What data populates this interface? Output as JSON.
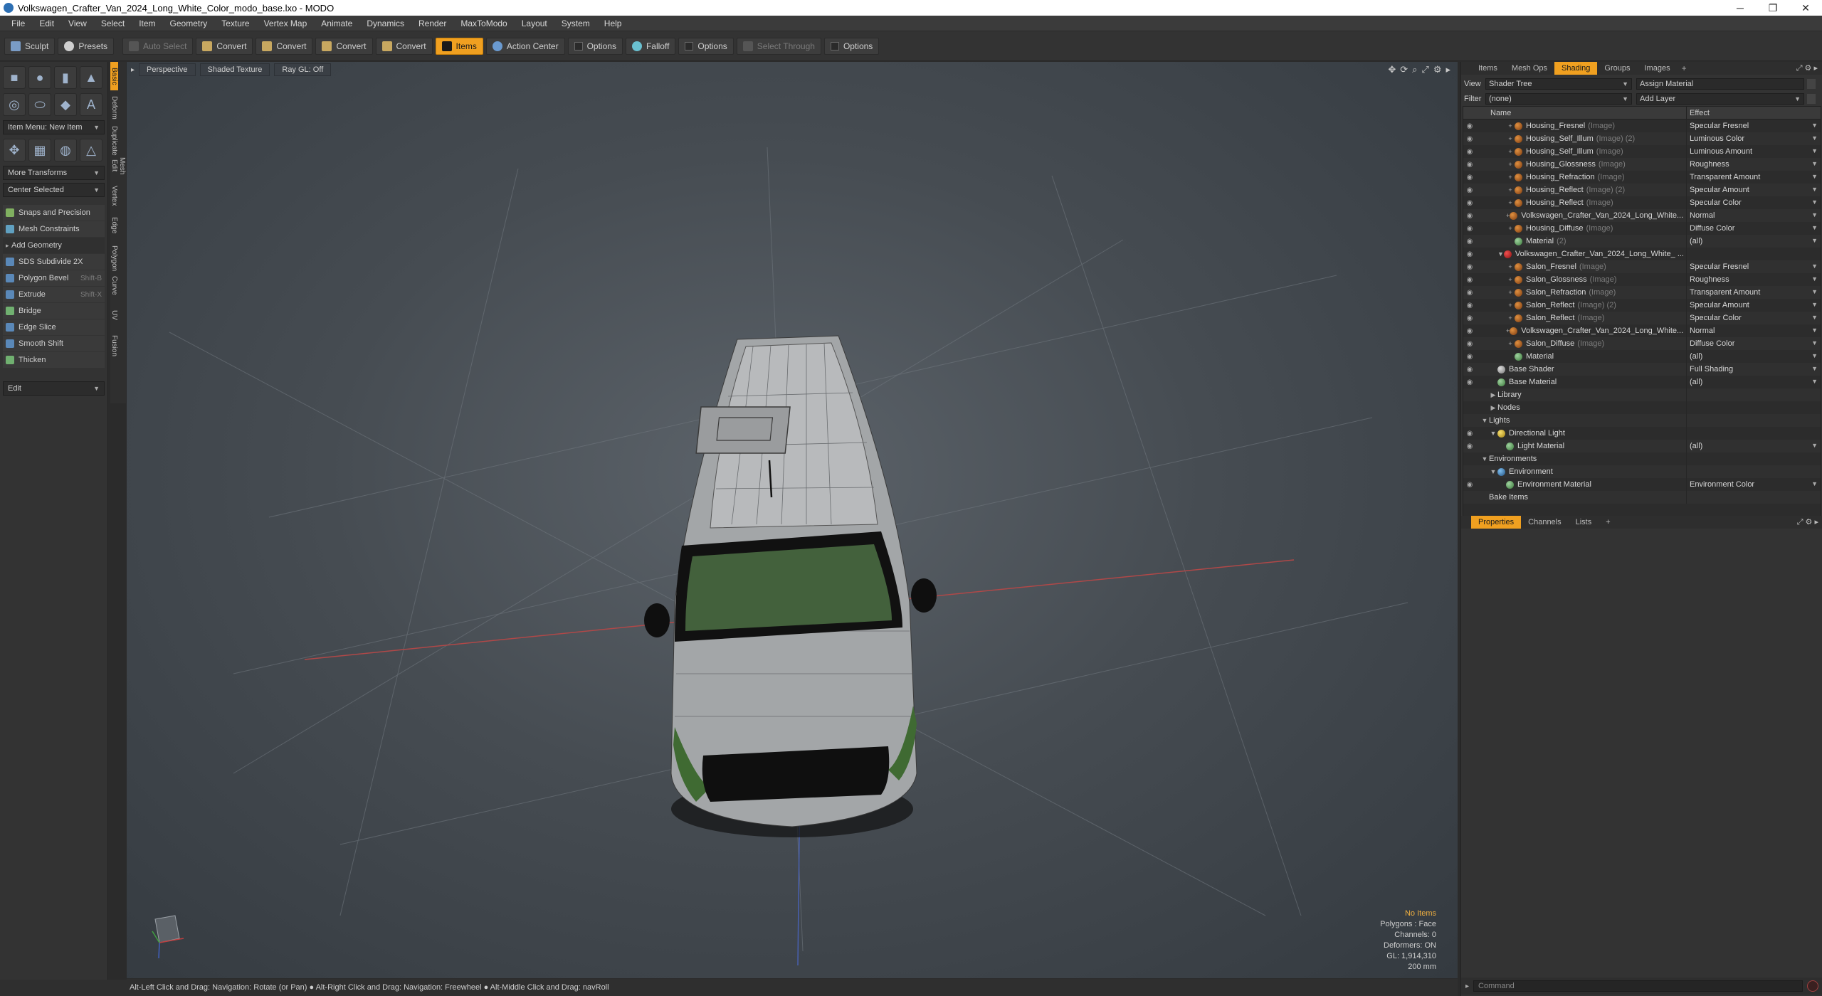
{
  "window": {
    "title": "Volkswagen_Crafter_Van_2024_Long_White_Color_modo_base.lxo - MODO",
    "minimize": "─",
    "maximize": "❐",
    "close": "✕"
  },
  "menu": [
    "File",
    "Edit",
    "View",
    "Select",
    "Item",
    "Geometry",
    "Texture",
    "Vertex Map",
    "Animate",
    "Dynamics",
    "Render",
    "MaxToModo",
    "Layout",
    "System",
    "Help"
  ],
  "toolbar": {
    "sculpt": "Sculpt",
    "presets": "Presets",
    "auto_select": "Auto Select",
    "convert1": "Convert",
    "convert2": "Convert",
    "convert3": "Convert",
    "convert4": "Convert",
    "items": "Items",
    "action_center": "Action Center",
    "options1": "Options",
    "falloff": "Falloff",
    "options2": "Options",
    "select_through": "Select Through",
    "options3": "Options"
  },
  "left": {
    "item_menu": "Item Menu: New Item",
    "more_transforms": "More Transforms",
    "center_selected": "Center Selected",
    "snaps": "Snaps and Precision",
    "constraints": "Mesh Constraints",
    "add_geometry": "Add Geometry",
    "tools": [
      {
        "label": "SDS Subdivide 2X",
        "shortcut": ""
      },
      {
        "label": "Polygon Bevel",
        "shortcut": "Shift-B"
      },
      {
        "label": "Extrude",
        "shortcut": "Shift-X"
      },
      {
        "label": "Bridge",
        "shortcut": ""
      },
      {
        "label": "Edge Slice",
        "shortcut": ""
      },
      {
        "label": "Smooth Shift",
        "shortcut": ""
      },
      {
        "label": "Thicken",
        "shortcut": ""
      }
    ],
    "edit": "Edit",
    "vtabs": [
      "Basic",
      "Deform",
      "Duplicate",
      "Mesh Edit",
      "Vertex",
      "Edge",
      "Polygon",
      "Curve",
      "UV",
      "Fusion"
    ]
  },
  "viewport": {
    "perspective": "Perspective",
    "shaded": "Shaded Texture",
    "raygl": "Ray GL: Off",
    "info": {
      "items": "No Items",
      "polygons": "Polygons : Face",
      "channels": "Channels: 0",
      "deformers": "Deformers: ON",
      "gl": "GL: 1,914,310",
      "scale": "200 mm"
    }
  },
  "status": "Alt-Left Click and Drag: Navigation: Rotate (or Pan) ● Alt-Right Click and Drag: Navigation: Freewheel ● Alt-Middle Click and Drag: navRoll",
  "right": {
    "tabs": [
      "Items",
      "Mesh Ops",
      "Shading",
      "Groups",
      "Images"
    ],
    "view_label": "View",
    "view_value": "Shader Tree",
    "assign_material": "Assign Material",
    "filter_label": "Filter",
    "filter_value": "(none)",
    "add_layer": "Add Layer",
    "col_name": "Name",
    "col_effect": "Effect",
    "rows": [
      {
        "indent": 3,
        "icon": "dot",
        "name": "Housing_Fresnel",
        "tag": "(Image)",
        "effect": "Specular Fresnel",
        "eye": true
      },
      {
        "indent": 3,
        "icon": "dot",
        "name": "Housing_Self_Illum",
        "tag": "(Image) (2)",
        "effect": "Luminous Color",
        "eye": true
      },
      {
        "indent": 3,
        "icon": "dot",
        "name": "Housing_Self_Illum",
        "tag": "(Image)",
        "effect": "Luminous Amount",
        "eye": true
      },
      {
        "indent": 3,
        "icon": "dot",
        "name": "Housing_Glossness",
        "tag": "(Image)",
        "effect": "Roughness",
        "eye": true
      },
      {
        "indent": 3,
        "icon": "dot",
        "name": "Housing_Refraction",
        "tag": "(Image)",
        "effect": "Transparent Amount",
        "eye": true
      },
      {
        "indent": 3,
        "icon": "dot",
        "name": "Housing_Reflect",
        "tag": "(Image) (2)",
        "effect": "Specular Amount",
        "eye": true
      },
      {
        "indent": 3,
        "icon": "dot",
        "name": "Housing_Reflect",
        "tag": "(Image)",
        "effect": "Specular Color",
        "eye": true
      },
      {
        "indent": 3,
        "icon": "dot",
        "name": "Volkswagen_Crafter_Van_2024_Long_White...",
        "tag": "",
        "effect": "Normal",
        "eye": true
      },
      {
        "indent": 3,
        "icon": "dot",
        "name": "Housing_Diffuse",
        "tag": "(Image)",
        "effect": "Diffuse Color",
        "eye": true
      },
      {
        "indent": 3,
        "icon": "mat",
        "name": "Material",
        "tag": "(2)",
        "effect": "(all)",
        "eye": true
      },
      {
        "indent": 2,
        "icon": "grp",
        "name": "Volkswagen_Crafter_Van_2024_Long_White_ ...",
        "tag": "",
        "effect": "",
        "eye": true,
        "twirl": "▼"
      },
      {
        "indent": 3,
        "icon": "dot",
        "name": "Salon_Fresnel",
        "tag": "(Image)",
        "effect": "Specular Fresnel",
        "eye": true
      },
      {
        "indent": 3,
        "icon": "dot",
        "name": "Salon_Glossness",
        "tag": "(Image)",
        "effect": "Roughness",
        "eye": true
      },
      {
        "indent": 3,
        "icon": "dot",
        "name": "Salon_Refraction",
        "tag": "(Image)",
        "effect": "Transparent Amount",
        "eye": true
      },
      {
        "indent": 3,
        "icon": "dot",
        "name": "Salon_Reflect",
        "tag": "(Image) (2)",
        "effect": "Specular Amount",
        "eye": true
      },
      {
        "indent": 3,
        "icon": "dot",
        "name": "Salon_Reflect",
        "tag": "(Image)",
        "effect": "Specular Color",
        "eye": true
      },
      {
        "indent": 3,
        "icon": "dot",
        "name": "Volkswagen_Crafter_Van_2024_Long_White...",
        "tag": "",
        "effect": "Normal",
        "eye": true
      },
      {
        "indent": 3,
        "icon": "dot",
        "name": "Salon_Diffuse",
        "tag": "(Image)",
        "effect": "Diffuse Color",
        "eye": true
      },
      {
        "indent": 3,
        "icon": "mat",
        "name": "Material",
        "tag": "",
        "effect": "(all)",
        "eye": true
      },
      {
        "indent": 1,
        "icon": "sh",
        "name": "Base Shader",
        "tag": "",
        "effect": "Full Shading",
        "eye": true
      },
      {
        "indent": 1,
        "icon": "mat",
        "name": "Base Material",
        "tag": "",
        "effect": "(all)",
        "eye": true
      },
      {
        "indent": 1,
        "icon": "none",
        "name": "Library",
        "tag": "",
        "effect": "",
        "eye": false,
        "twirl": "▶"
      },
      {
        "indent": 1,
        "icon": "none",
        "name": "Nodes",
        "tag": "",
        "effect": "",
        "eye": false,
        "twirl": "▶"
      },
      {
        "indent": 0,
        "icon": "none",
        "name": "Lights",
        "tag": "",
        "effect": "",
        "eye": false,
        "twirl": "▼"
      },
      {
        "indent": 1,
        "icon": "lt",
        "name": "Directional Light",
        "tag": "",
        "effect": "",
        "eye": true,
        "twirl": "▼"
      },
      {
        "indent": 2,
        "icon": "mat",
        "name": "Light Material",
        "tag": "",
        "effect": "(all)",
        "eye": true
      },
      {
        "indent": 0,
        "icon": "none",
        "name": "Environments",
        "tag": "",
        "effect": "",
        "eye": false,
        "twirl": "▼"
      },
      {
        "indent": 1,
        "icon": "env",
        "name": "Environment",
        "tag": "",
        "effect": "",
        "eye": false,
        "twirl": "▼"
      },
      {
        "indent": 2,
        "icon": "mat",
        "name": "Environment Material",
        "tag": "",
        "effect": "Environment Color",
        "eye": true
      },
      {
        "indent": 0,
        "icon": "none",
        "name": "Bake Items",
        "tag": "",
        "effect": "",
        "eye": false
      }
    ],
    "prop_tabs": [
      "Properties",
      "Channels",
      "Lists"
    ],
    "command_placeholder": "Command"
  }
}
